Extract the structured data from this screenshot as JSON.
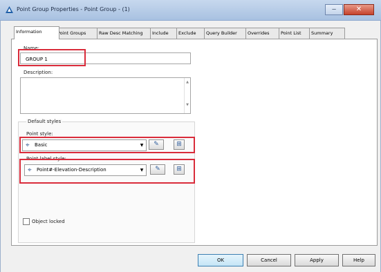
{
  "window": {
    "title": "Point Group Properties - Point Group - (1)",
    "minimize_glyph": "‒",
    "close_glyph": "✕"
  },
  "tabs": [
    {
      "label": "Information",
      "active": true
    },
    {
      "label": "Point Groups"
    },
    {
      "label": "Raw Desc Matching"
    },
    {
      "label": "Include"
    },
    {
      "label": "Exclude"
    },
    {
      "label": "Query Builder"
    },
    {
      "label": "Overrides"
    },
    {
      "label": "Point List"
    },
    {
      "label": "Summary"
    }
  ],
  "information": {
    "name_label": "Name:",
    "name_value": "GROUP 1",
    "description_label": "Description:",
    "description_value": "",
    "default_styles_label": "Default styles",
    "point_style_label": "Point style:",
    "point_style_value": "Basic",
    "point_label_style_label": "Point label style:",
    "point_label_style_value": "Point#-Elevation-Description",
    "object_locked_label": "Object locked",
    "object_locked_checked": false
  },
  "icons": {
    "style_edit": "✎",
    "style_browse": "⊞",
    "point_marker": "⌖",
    "dropdown": "▼"
  },
  "buttons": {
    "ok": "OK",
    "cancel": "Cancel",
    "apply": "Apply",
    "help": "Help"
  },
  "colors": {
    "highlight": "#d92b3a",
    "title_bar": "#b4cbe8",
    "close_button": "#c5432c"
  }
}
